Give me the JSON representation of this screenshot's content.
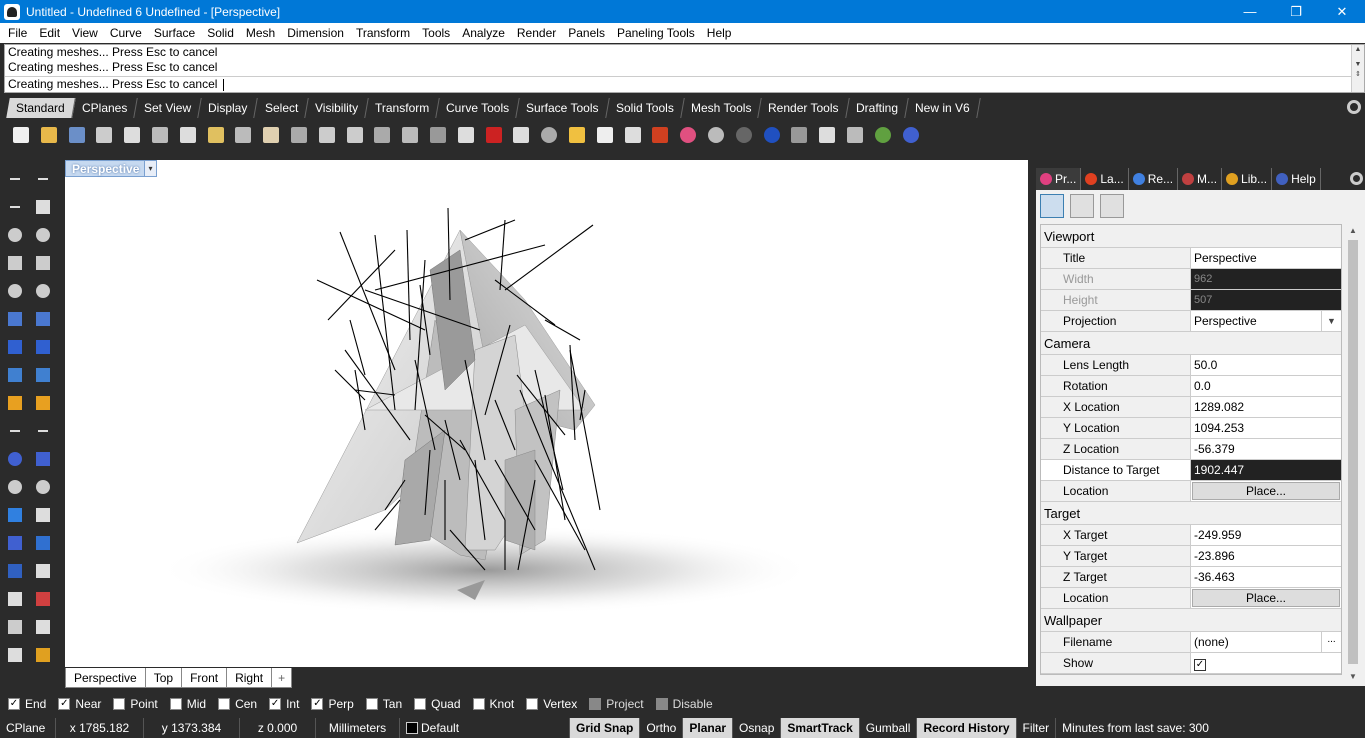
{
  "titlebar": {
    "title": "Untitled - Undefined 6 Undefined - [Perspective]",
    "minimize": "—",
    "restore": "❐",
    "close": "✕"
  },
  "menu": [
    "File",
    "Edit",
    "View",
    "Curve",
    "Surface",
    "Solid",
    "Mesh",
    "Dimension",
    "Transform",
    "Tools",
    "Analyze",
    "Render",
    "Panels",
    "Paneling Tools",
    "Help"
  ],
  "command": {
    "history": [
      "Creating meshes... Press Esc to cancel",
      "Creating meshes... Press Esc to cancel"
    ],
    "prompt": "Creating meshes... Press Esc to cancel"
  },
  "toolbar_tabs": [
    "Standard",
    "CPlanes",
    "Set View",
    "Display",
    "Select",
    "Visibility",
    "Transform",
    "Curve Tools",
    "Surface Tools",
    "Solid Tools",
    "Mesh Tools",
    "Render Tools",
    "Drafting",
    "New in V6"
  ],
  "toolbar_icons": [
    "new-icon",
    "open-icon",
    "save-icon",
    "print-icon",
    "properties-icon",
    "cut-icon",
    "copy-icon",
    "paste-icon",
    "undo-icon",
    "pan-icon",
    "move-view-icon",
    "zoom-icon",
    "zoom-window-icon",
    "zoom-extents-icon",
    "zoom-selected-icon",
    "rotate-view-icon",
    "four-viewports-icon",
    "car-icon",
    "point-icon",
    "circle-icon",
    "lights-icon",
    "bulb-icon",
    "lock-icon",
    "material-icon",
    "color-wheel-icon",
    "sphere-gray-icon",
    "sphere-dark-icon",
    "sphere-blue-icon",
    "render-cube-icon",
    "settings-icon",
    "select-box-icon",
    "globe-icon",
    "help-icon"
  ],
  "toolbar_icon_colors": [
    "#f0f0f0",
    "#e8b84a",
    "#6b8fc8",
    "#cccccc",
    "#dddddd",
    "#bbbbbb",
    "#dddddd",
    "#e0c060",
    "#bbbbbb",
    "#e0d0b0",
    "#aaaaaa",
    "#cccccc",
    "#cccccc",
    "#aaaaaa",
    "#bbbbbb",
    "#999999",
    "#dddddd",
    "#cc2222",
    "#dddddd",
    "#aaaaaa",
    "#f0c040",
    "#eeeeee",
    "#dddddd",
    "#d04020",
    "#e05080",
    "#bbbbbb",
    "#666666",
    "#2050c0",
    "#999999",
    "#dddddd",
    "#bbbbbb",
    "#60a040",
    "#4060d0"
  ],
  "viewport": {
    "label": "Perspective",
    "tabs": [
      "Perspective",
      "Top",
      "Front",
      "Right"
    ],
    "add_tab": "+"
  },
  "panel_tabs": [
    {
      "label": "Pr...",
      "color": "#e04080"
    },
    {
      "label": "La...",
      "color": "#e04020"
    },
    {
      "label": "Re...",
      "color": "#4080e0"
    },
    {
      "label": "M...",
      "color": "#c04040"
    },
    {
      "label": "Lib...",
      "color": "#e0a020"
    },
    {
      "label": "Help",
      "color": "#4060c0"
    }
  ],
  "properties": {
    "viewport_section": "Viewport",
    "title_label": "Title",
    "title_value": "Perspective",
    "width_label": "Width",
    "width_value": "962",
    "height_label": "Height",
    "height_value": "507",
    "projection_label": "Projection",
    "projection_value": "Perspective",
    "camera_section": "Camera",
    "lens_label": "Lens Length",
    "lens_value": "50.0",
    "rotation_label": "Rotation",
    "rotation_value": "0.0",
    "xloc_label": "X Location",
    "xloc_value": "1289.082",
    "yloc_label": "Y Location",
    "yloc_value": "1094.253",
    "zloc_label": "Z Location",
    "zloc_value": "-56.379",
    "dist_label": "Distance to Target",
    "dist_value": "1902.447",
    "location_label": "Location",
    "place_button": "Place...",
    "target_section": "Target",
    "xtarget_label": "X Target",
    "xtarget_value": "-249.959",
    "ytarget_label": "Y Target",
    "ytarget_value": "-23.896",
    "ztarget_label": "Z Target",
    "ztarget_value": "-36.463",
    "target_location_label": "Location",
    "target_place_button": "Place...",
    "wallpaper_section": "Wallpaper",
    "filename_label": "Filename",
    "filename_value": "(none)",
    "browse": "...",
    "show_label": "Show",
    "show_checked": "✓"
  },
  "osnaps": [
    {
      "label": "End",
      "checked": "✓"
    },
    {
      "label": "Near",
      "checked": "✓"
    },
    {
      "label": "Point",
      "checked": ""
    },
    {
      "label": "Mid",
      "checked": ""
    },
    {
      "label": "Cen",
      "checked": ""
    },
    {
      "label": "Int",
      "checked": "✓"
    },
    {
      "label": "Perp",
      "checked": "✓"
    },
    {
      "label": "Tan",
      "checked": ""
    },
    {
      "label": "Quad",
      "checked": ""
    },
    {
      "label": "Knot",
      "checked": ""
    },
    {
      "label": "Vertex",
      "checked": ""
    },
    {
      "label": "Project",
      "checked": ""
    },
    {
      "label": "Disable",
      "checked": ""
    }
  ],
  "status": {
    "cplane": "CPlane",
    "x": "x 1785.182",
    "y": "y 1373.384",
    "z": "z 0.000",
    "units": "Millimeters",
    "layer": "Default",
    "grid_snap": "Grid Snap",
    "ortho": "Ortho",
    "planar": "Planar",
    "osnap": "Osnap",
    "smarttrack": "SmartTrack",
    "gumball": "Gumball",
    "record_history": "Record History",
    "filter": "Filter",
    "minutes": "Minutes from last save: 300"
  }
}
